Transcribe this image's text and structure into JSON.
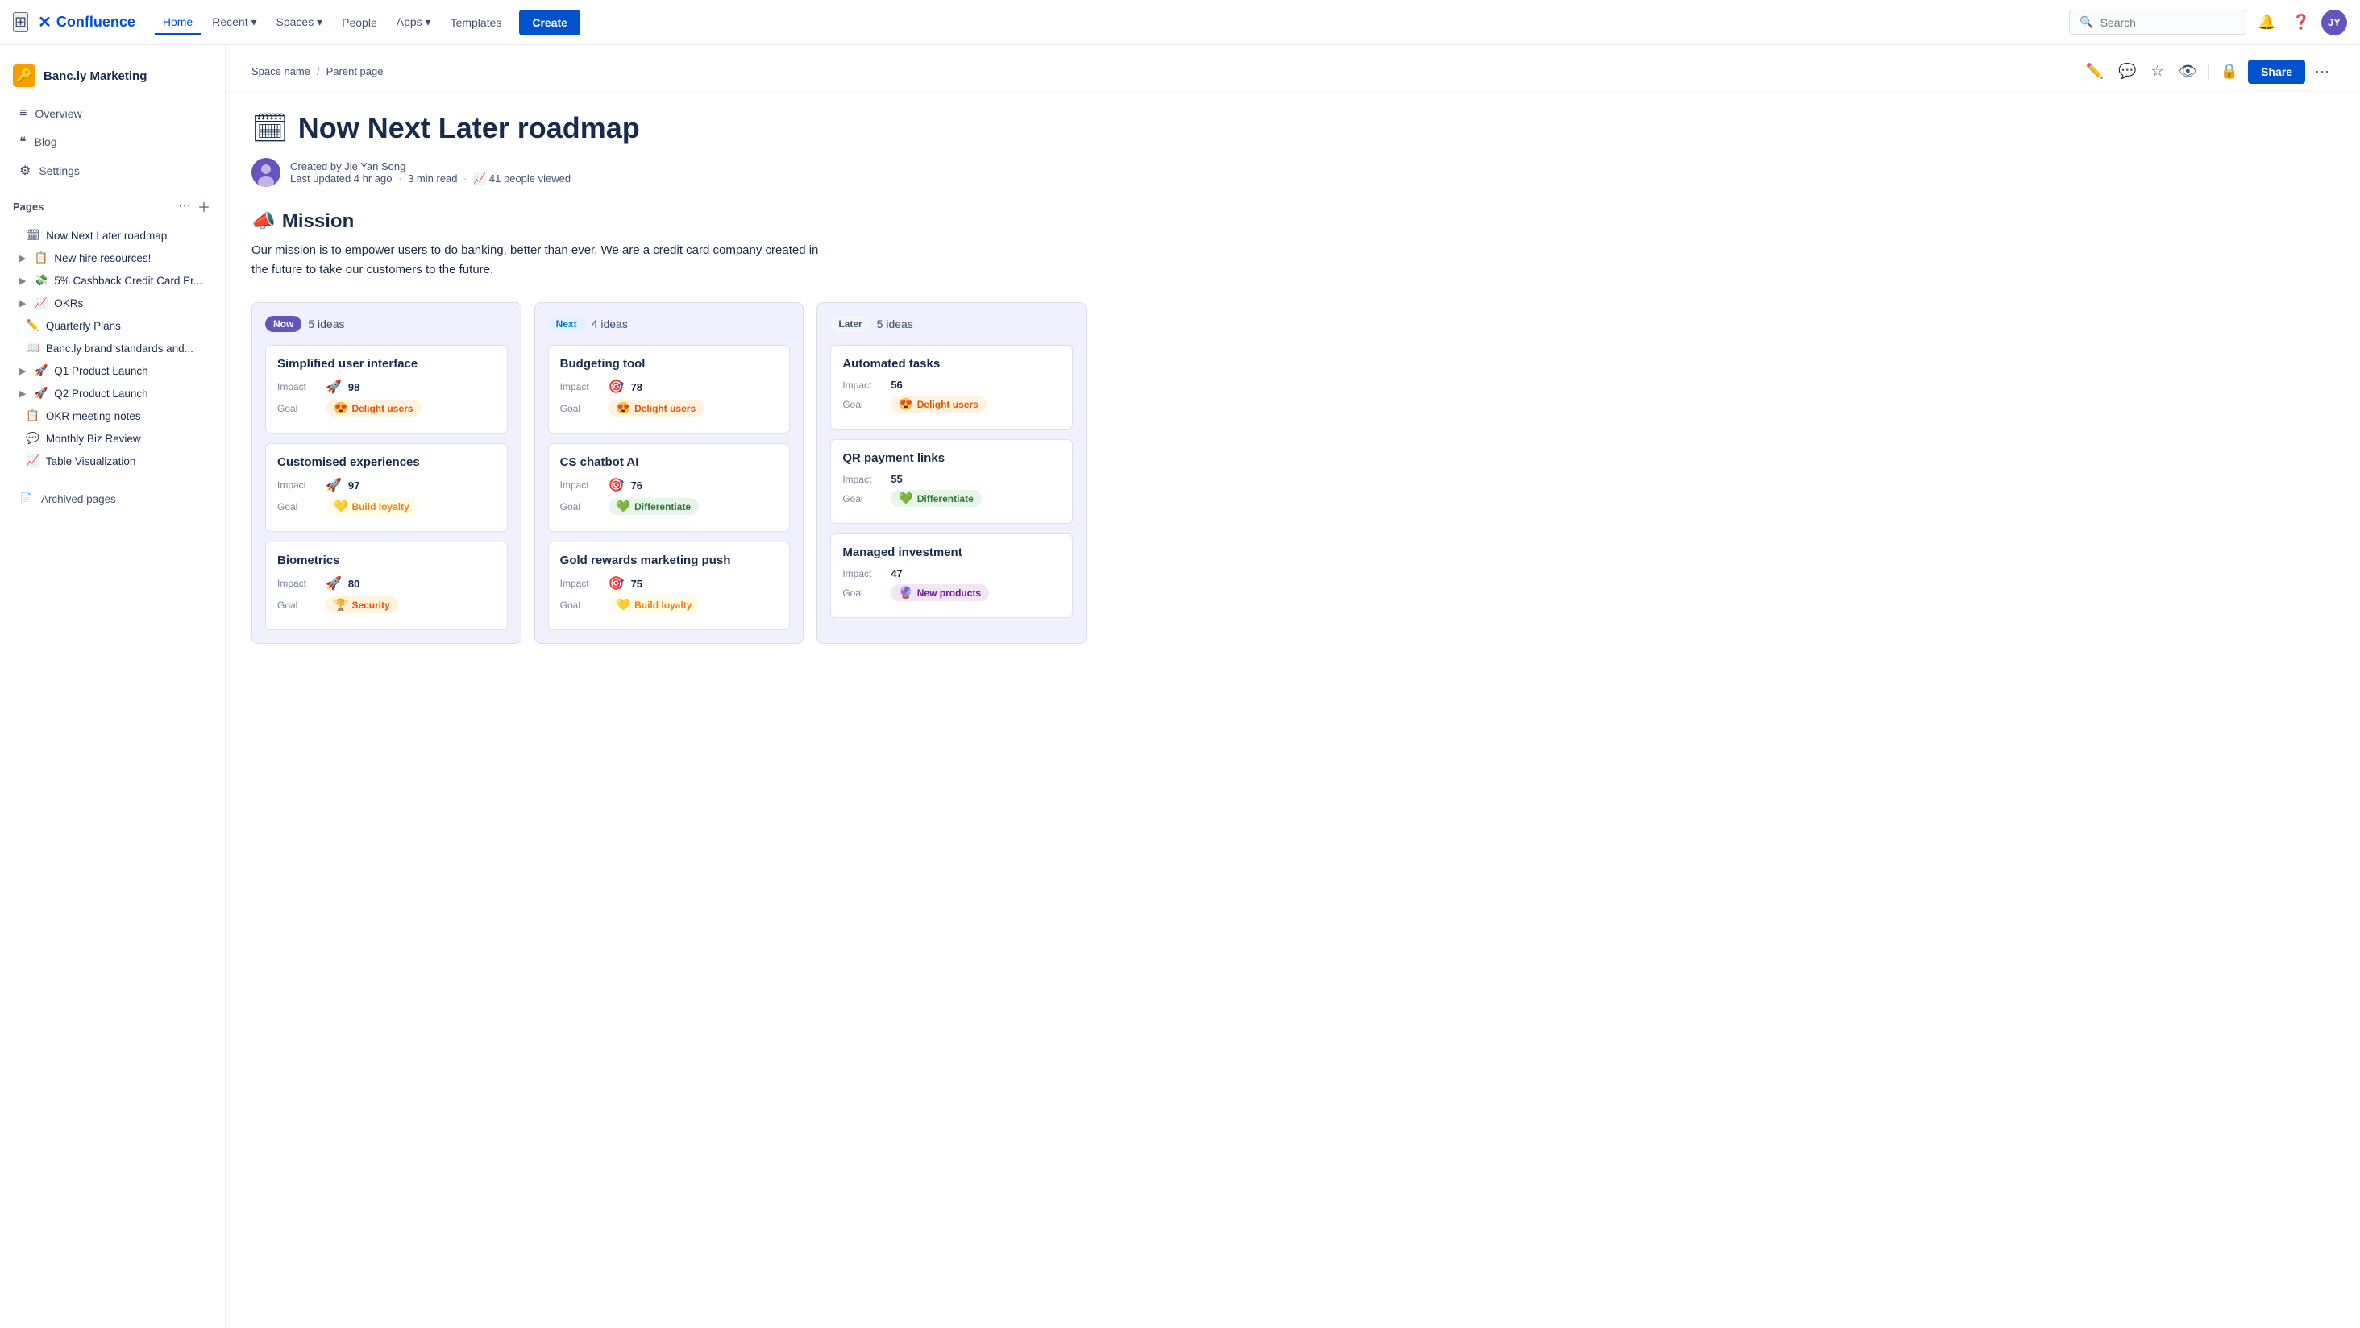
{
  "topnav": {
    "logo_text": "Confluence",
    "links": [
      {
        "id": "home",
        "label": "Home",
        "active": true
      },
      {
        "id": "recent",
        "label": "Recent",
        "has_dropdown": true
      },
      {
        "id": "spaces",
        "label": "Spaces",
        "has_dropdown": true
      },
      {
        "id": "people",
        "label": "People",
        "has_dropdown": false
      },
      {
        "id": "apps",
        "label": "Apps",
        "has_dropdown": true
      },
      {
        "id": "templates",
        "label": "Templates",
        "has_dropdown": false
      }
    ],
    "create_label": "Create",
    "search_placeholder": "Search"
  },
  "sidebar": {
    "workspace_name": "Banc.ly Marketing",
    "workspace_emoji": "🔑",
    "nav_items": [
      {
        "id": "overview",
        "icon": "≡",
        "label": "Overview"
      },
      {
        "id": "blog",
        "icon": "❝",
        "label": "Blog"
      },
      {
        "id": "settings",
        "icon": "⚙",
        "label": "Settings"
      }
    ],
    "pages_section_label": "Pages",
    "pages": [
      {
        "id": "now-next-later",
        "emoji": "🗓",
        "label": "Now Next Later roadmap",
        "indent": false,
        "has_children": false
      },
      {
        "id": "new-hire",
        "emoji": "📋",
        "label": "New hire resources!",
        "indent": false,
        "has_children": true
      },
      {
        "id": "cashback",
        "emoji": "💸",
        "label": "5% Cashback Credit Card Pr...",
        "indent": false,
        "has_children": true
      },
      {
        "id": "okrs",
        "emoji": "📈",
        "label": "OKRs",
        "indent": false,
        "has_children": true
      },
      {
        "id": "quarterly",
        "emoji": "✏️",
        "label": "Quarterly Plans",
        "indent": false,
        "has_children": false
      },
      {
        "id": "brand",
        "emoji": "📖",
        "label": "Banc.ly brand standards and...",
        "indent": false,
        "has_children": false
      },
      {
        "id": "q1-launch",
        "emoji": "🚀",
        "label": "Q1 Product Launch",
        "indent": false,
        "has_children": true
      },
      {
        "id": "q2-launch",
        "emoji": "🚀",
        "label": "Q2 Product Launch",
        "indent": false,
        "has_children": true
      },
      {
        "id": "okr-meeting",
        "emoji": "📋",
        "label": "OKR meeting notes",
        "indent": false,
        "has_children": false
      },
      {
        "id": "monthly-biz",
        "emoji": "💬",
        "label": "Monthly Biz Review",
        "indent": false,
        "has_children": false
      },
      {
        "id": "table-viz",
        "emoji": "📈",
        "label": "Table Visualization",
        "indent": false,
        "has_children": false
      }
    ],
    "archived_label": "Archived pages",
    "archived_icon": "📄"
  },
  "breadcrumb": {
    "space": "Space name",
    "parent": "Parent page"
  },
  "page": {
    "title_emoji": "🗓",
    "title": "Now Next Later roadmap",
    "author_name": "Jie Yan Song",
    "created_label": "Created by Jie Yan Song",
    "last_updated": "Last updated 4 hr ago",
    "read_time": "3 min read",
    "viewers": "41 people viewed",
    "share_label": "Share"
  },
  "mission": {
    "emoji": "📣",
    "title": "Mission",
    "text": "Our mission is to empower users to do banking, better than ever. We are a credit card company created in the future to take our customers to the future."
  },
  "roadmap": {
    "columns": [
      {
        "id": "now",
        "badge": "Now",
        "badge_style": "now",
        "ideas_count": "5 ideas",
        "cards": [
          {
            "title": "Simplified user interface",
            "impact_icon": "🚀",
            "impact_num": "98",
            "goal_emoji": "😍",
            "goal_label": "Delight users",
            "goal_style": "delight"
          },
          {
            "title": "Customised experiences",
            "impact_icon": "🚀",
            "impact_num": "97",
            "goal_emoji": "💛",
            "goal_label": "Build loyalty",
            "goal_style": "loyalty"
          },
          {
            "title": "Biometrics",
            "impact_icon": "🚀",
            "impact_num": "80",
            "goal_emoji": "🏆",
            "goal_label": "Security",
            "goal_style": "security"
          }
        ]
      },
      {
        "id": "next",
        "badge": "Next",
        "badge_style": "next",
        "ideas_count": "4 ideas",
        "cards": [
          {
            "title": "Budgeting tool",
            "impact_icon": "🎯",
            "impact_num": "78",
            "goal_emoji": "😍",
            "goal_label": "Delight users",
            "goal_style": "delight"
          },
          {
            "title": "CS chatbot AI",
            "impact_icon": "🎯",
            "impact_num": "76",
            "goal_emoji": "💚",
            "goal_label": "Differentiate",
            "goal_style": "differentiate"
          },
          {
            "title": "Gold rewards marketing push",
            "impact_icon": "🎯",
            "impact_num": "75",
            "goal_emoji": "💛",
            "goal_label": "Build loyalty",
            "goal_style": "loyalty"
          }
        ]
      },
      {
        "id": "later",
        "badge": "Later",
        "badge_style": "later",
        "ideas_count": "5 ideas",
        "cards": [
          {
            "title": "Automated tasks",
            "impact_icon": "",
            "impact_num": "56",
            "goal_emoji": "😍",
            "goal_label": "Delight users",
            "goal_style": "delight"
          },
          {
            "title": "QR payment links",
            "impact_icon": "",
            "impact_num": "55",
            "goal_emoji": "💚",
            "goal_label": "Differentiate",
            "goal_style": "differentiate"
          },
          {
            "title": "Managed investment",
            "impact_icon": "",
            "impact_num": "47",
            "goal_emoji": "🔮",
            "goal_label": "New products",
            "goal_style": "new-products"
          }
        ]
      }
    ]
  }
}
